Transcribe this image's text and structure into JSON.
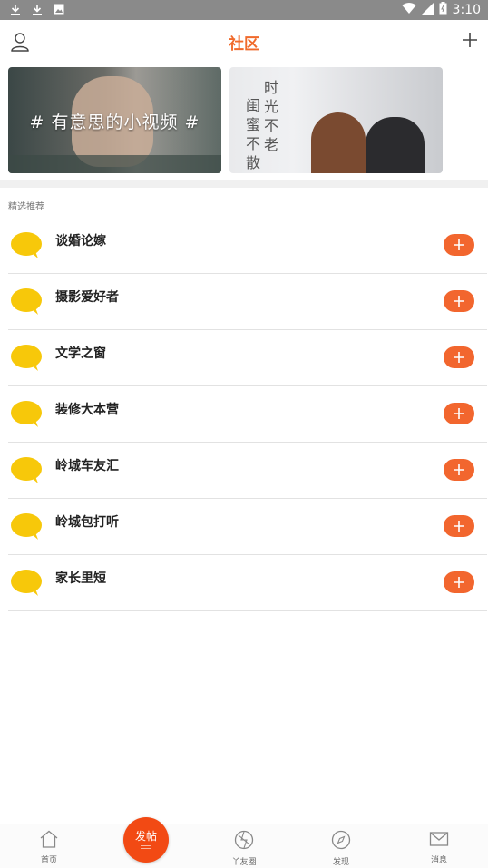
{
  "statusbar": {
    "time": "3:10"
  },
  "header": {
    "title": "社区"
  },
  "banners": [
    {
      "caption": "# 有意思的小视频 #"
    },
    {
      "col1": "闺蜜不散",
      "col2": "时光不老"
    }
  ],
  "section": {
    "label": "精选推荐"
  },
  "communities": [
    {
      "name": "谈婚论嫁"
    },
    {
      "name": "摄影爱好者"
    },
    {
      "name": "文学之窗"
    },
    {
      "name": "装修大本营"
    },
    {
      "name": "岭城车友汇"
    },
    {
      "name": "岭城包打听"
    },
    {
      "name": "家长里短"
    }
  ],
  "nav": {
    "home": "首页",
    "post": "发帖",
    "friends": "丫友圈",
    "discover": "发现",
    "messages": "消息"
  },
  "colors": {
    "accent": "#f06a2b",
    "add_button": "#f2662e",
    "bubble": "#f7c80a",
    "post_button": "#f24a14"
  },
  "icons": [
    "download-icon",
    "image-icon",
    "wifi-icon",
    "signal-icon",
    "battery-icon",
    "user-icon",
    "plus-icon",
    "chat-bubble-icon",
    "home-icon",
    "friends-circle-icon",
    "compass-icon",
    "mail-icon"
  ]
}
